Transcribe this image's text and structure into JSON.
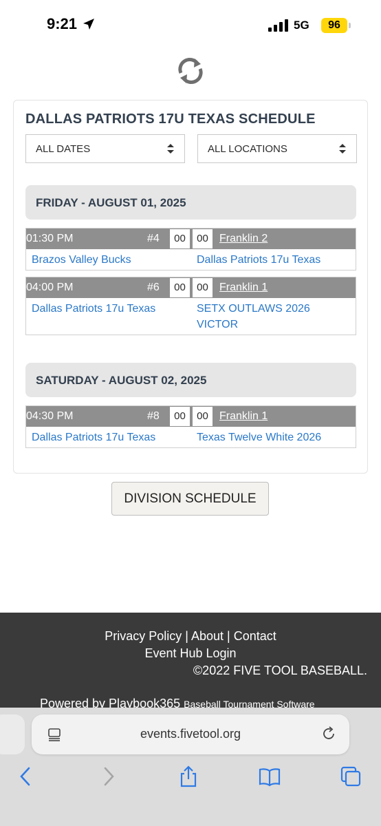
{
  "status_bar": {
    "time": "9:21",
    "network": "5G",
    "battery": "96"
  },
  "card": {
    "title": "DALLAS PATRIOTS 17U TEXAS SCHEDULE",
    "filters": {
      "dates": "ALL DATES",
      "locations": "ALL LOCATIONS"
    }
  },
  "days": [
    {
      "header": "FRIDAY - AUGUST 01, 2025",
      "games": [
        {
          "time": "01:30 PM",
          "number": "#4",
          "score_home": "00",
          "score_away": "00",
          "field": "Franklin 2",
          "team1": "Brazos Valley Bucks",
          "team2": "Dallas Patriots 17u Texas"
        },
        {
          "time": "04:00 PM",
          "number": "#6",
          "score_home": "00",
          "score_away": "00",
          "field": "Franklin 1",
          "team1": "Dallas Patriots 17u Texas",
          "team2": "SETX OUTLAWS 2026 VICTOR"
        }
      ]
    },
    {
      "header": "SATURDAY - AUGUST 02, 2025",
      "games": [
        {
          "time": "04:30 PM",
          "number": "#8",
          "score_home": "00",
          "score_away": "00",
          "field": "Franklin 1",
          "team1": "Dallas Patriots 17u Texas",
          "team2": "Texas Twelve White 2026"
        }
      ]
    }
  ],
  "division_button": "DIVISION SCHEDULE",
  "footer": {
    "privacy": "Privacy Policy",
    "about": "About",
    "contact": "Contact",
    "sep": "|",
    "login": "Event Hub Login",
    "copyright": "©2022 FIVE TOOL BASEBALL.",
    "powered_main": "Powered by Playbook365",
    "powered_small": "Baseball Tournament Software"
  },
  "browser": {
    "url": "events.fivetool.org"
  },
  "colors": {
    "link": "#2a78c8",
    "game_bar": "#8f8f8f",
    "footer_bg": "#3a3a3a",
    "title": "#33404f",
    "battery": "#ffd60a"
  },
  "icons": [
    "location-arrow-icon",
    "signal-icon",
    "refresh-icon",
    "select-arrows-icon",
    "reader-icon",
    "reload-icon",
    "back-icon",
    "forward-icon",
    "share-icon",
    "bookmarks-icon",
    "tabs-icon"
  ]
}
